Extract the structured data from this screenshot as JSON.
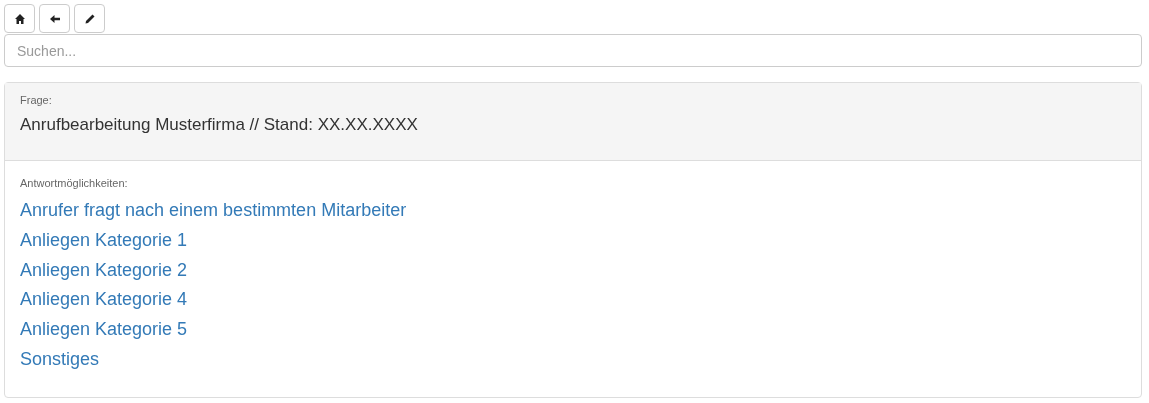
{
  "toolbar": [
    {
      "kind": "home"
    },
    {
      "kind": "back"
    },
    {
      "kind": "edit"
    }
  ],
  "search": {
    "placeholder": "Suchen..."
  },
  "question": {
    "label": "Frage:",
    "text": "Anrufbearbeitung Musterfirma // Stand: XX.XX.XXXX"
  },
  "answers": {
    "label": "Antwortmöglichkeiten:",
    "items": [
      "Anrufer fragt nach einem bestimmten Mitarbeiter",
      "Anliegen Kategorie 1",
      "Anliegen Kategorie 2",
      "Anliegen Kategorie 4",
      "Anliegen Kategorie 5",
      "Sonstiges"
    ]
  }
}
